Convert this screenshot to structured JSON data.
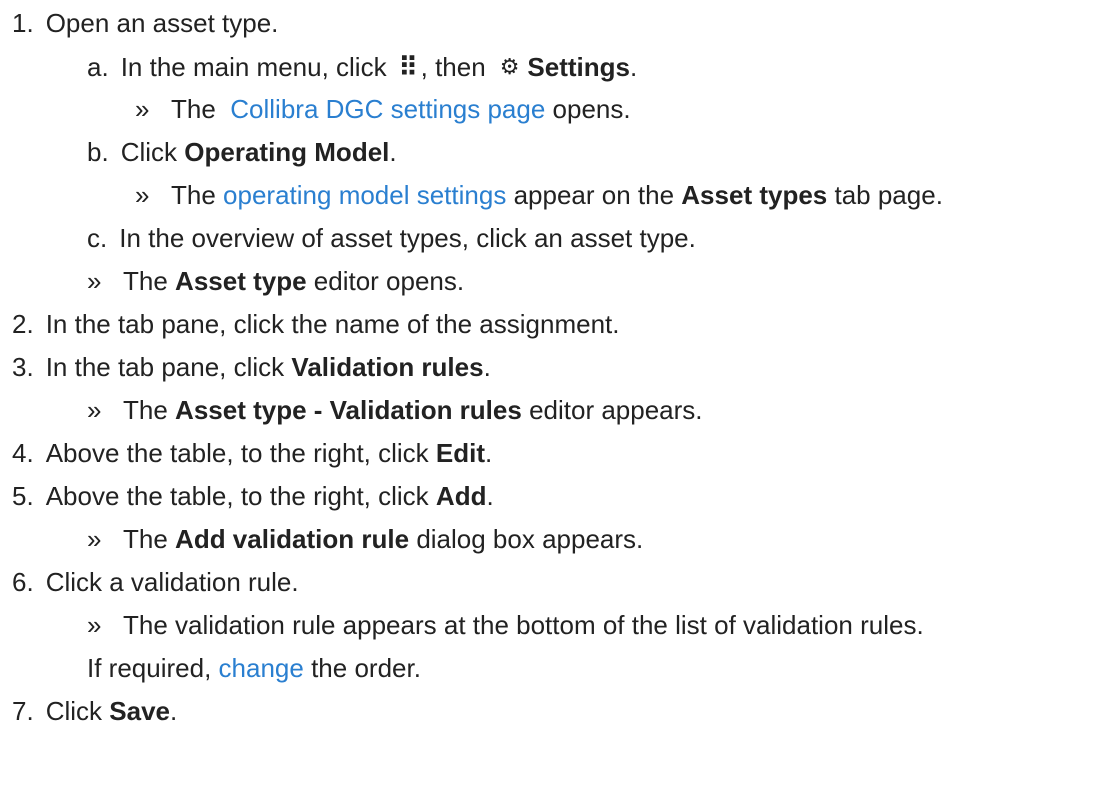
{
  "steps": [
    {
      "n": "1.",
      "text": "Open an asset type."
    },
    {
      "n": "a.",
      "pre": "In the main menu, click",
      "mid": ", then",
      "strong": "Settings",
      "end": "."
    },
    {
      "r": "»",
      "pre": "The",
      "link": "Collibra DGC settings page",
      "post": "opens."
    },
    {
      "n": "b.",
      "pre": "Click",
      "strong": "Operating Model",
      "end": "."
    },
    {
      "r": "»",
      "pre": "The",
      "link": "operating model settings",
      "mid": "appear on the",
      "strong": "Asset types",
      "post": "tab page."
    },
    {
      "n": "c.",
      "text": "In the overview of asset types, click an asset type."
    },
    {
      "r": "»",
      "pre": "The",
      "strong": "Asset type",
      "post": "editor opens."
    },
    {
      "n": "2.",
      "text": "In the tab pane, click the name of the assignment."
    },
    {
      "n": "3.",
      "pre": "In the tab pane, click",
      "strong": "Validation rules",
      "end": "."
    },
    {
      "r": "»",
      "pre": "The",
      "strong": "Asset type - Validation rules",
      "post": "editor appears."
    },
    {
      "n": "4.",
      "pre": "Above the table, to the right, click",
      "strong": "Edit",
      "end": "."
    },
    {
      "n": "5.",
      "pre": "Above the table, to the right, click",
      "strong": "Add",
      "end": "."
    },
    {
      "r": "»",
      "pre": "The",
      "strong": "Add validation rule",
      "post": "dialog box appears."
    },
    {
      "n": "6.",
      "text": "Click a validation rule."
    },
    {
      "r": "»",
      "text": "The validation rule appears at the bottom of the list of validation rules."
    },
    {
      "pre": "If required,",
      "link": "change",
      "post": "the order."
    },
    {
      "n": "7.",
      "pre": "Click",
      "strong": "Save",
      "end": "."
    }
  ],
  "icons": {
    "apps": "apps-grid-icon",
    "settings": "gear-icon"
  },
  "colors": {
    "text": "#222222",
    "link": "#2a7fd0"
  }
}
